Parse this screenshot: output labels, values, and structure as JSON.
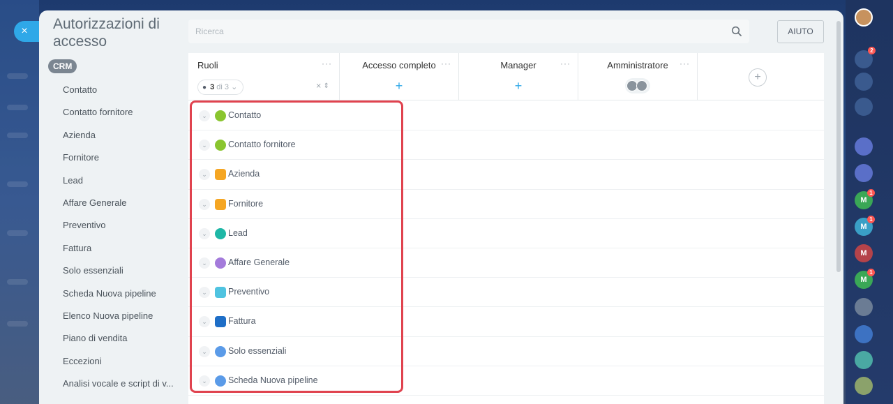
{
  "page": {
    "title": "Autorizzazioni di accesso",
    "close_label": "×",
    "section_badge": "CRM"
  },
  "sidebar": {
    "items": [
      {
        "label": "Contatto"
      },
      {
        "label": "Contatto fornitore"
      },
      {
        "label": "Azienda"
      },
      {
        "label": "Fornitore"
      },
      {
        "label": "Lead"
      },
      {
        "label": "Affare Generale"
      },
      {
        "label": "Preventivo"
      },
      {
        "label": "Fattura"
      },
      {
        "label": "Solo essenziali"
      },
      {
        "label": "Scheda Nuova pipeline"
      },
      {
        "label": "Elenco Nuova pipeline"
      },
      {
        "label": "Piano di vendita"
      },
      {
        "label": "Eccezioni"
      },
      {
        "label": "Analisi vocale e script di v..."
      }
    ]
  },
  "search": {
    "placeholder": "Ricerca"
  },
  "toolbar": {
    "help_label": "AIUTO"
  },
  "grid": {
    "columns": {
      "roles": "Ruoli",
      "full": "Accesso completo",
      "manager": "Manager",
      "admin": "Amministratore",
      "menu": "···",
      "plus": "+"
    },
    "counter": {
      "current": "3",
      "of_label": "di 3",
      "eye": "●"
    },
    "rows": [
      {
        "label": "Contatto",
        "color": "#8ac52f"
      },
      {
        "label": "Contatto fornitore",
        "color": "#8ac52f"
      },
      {
        "label": "Azienda",
        "color": "#f5a623"
      },
      {
        "label": "Fornitore",
        "color": "#f5a623"
      },
      {
        "label": "Lead",
        "color": "#1eb7a6"
      },
      {
        "label": "Affare Generale",
        "color": "#a47bdb"
      },
      {
        "label": "Preventivo",
        "color": "#4fc3e0"
      },
      {
        "label": "Fattura",
        "color": "#1e6ec7"
      },
      {
        "label": "Solo essenziali",
        "color": "#5b9be8"
      },
      {
        "label": "Scheda Nuova pipeline",
        "color": "#5b9be8"
      }
    ]
  },
  "rail": {
    "notifications_badge": "2",
    "avatars": [
      {
        "letter": "M",
        "badge": "1",
        "color": "#3aa756"
      },
      {
        "letter": "M",
        "badge": "1",
        "color": "#3a9fc6"
      },
      {
        "letter": "M",
        "badge": "",
        "color": "#b5434a"
      },
      {
        "letter": "M",
        "badge": "1",
        "color": "#3aa756"
      }
    ]
  },
  "colors": {
    "accent": "#2fa8e8",
    "highlight": "#e0434f"
  }
}
